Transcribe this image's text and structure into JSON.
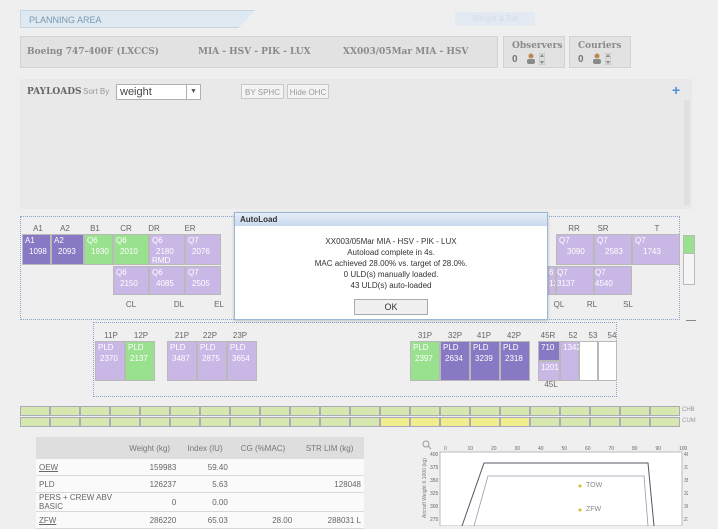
{
  "tabs": {
    "planning": "PLANNING AREA",
    "ghost": "Weight & Bal"
  },
  "flight": {
    "aircraft": "Boeing 747-400F (LXCCS)",
    "route": "MIA - HSV - PIK - LUX",
    "flight_id": "XX003/05Mar MIA - HSV"
  },
  "people": {
    "observers_label": "Observers",
    "observers_count": "0",
    "couriers_label": "Couriers",
    "couriers_count": "0"
  },
  "payloads": {
    "label": "PAYLOADS",
    "sort_label": "Sort By",
    "sort_value": "weight",
    "by_sphc": "BY SPHC",
    "hide_ohc": "Hide OHC",
    "add": "+"
  },
  "main_deck": {
    "top_labels": [
      "A1",
      "A2",
      "B1",
      "CR",
      "DR",
      "ER",
      "RR",
      "SR",
      "T"
    ],
    "cells_left": [
      {
        "k": "a1",
        "t": "A1",
        "w": "1098",
        "c": "dpurple"
      },
      {
        "k": "a2",
        "t": "A2",
        "w": "2093",
        "c": "dpurple"
      },
      {
        "k": "b1",
        "t": "Q6",
        "w": "1930",
        "c": "green"
      },
      {
        "k": "cr",
        "t": "Q6",
        "w": "2010",
        "c": "green"
      },
      {
        "k": "dr",
        "t": "Q6",
        "w": "2180",
        "c": "purple",
        "extra": "RMD"
      },
      {
        "k": "er",
        "t": "Q7",
        "w": "2076",
        "c": "purple"
      }
    ],
    "cells_left_lower": [
      {
        "k": "cl",
        "t": "Q6",
        "w": "2150",
        "c": "purple"
      },
      {
        "k": "dl",
        "t": "Q6",
        "w": "4085",
        "c": "purple"
      },
      {
        "k": "el",
        "t": "Q7",
        "w": "2505",
        "c": "purple"
      }
    ],
    "bottom_labels": [
      "CL",
      "DL",
      "EL",
      "QL",
      "RL",
      "SL"
    ],
    "cells_right": [
      {
        "k": "rr",
        "t": "Q7",
        "w": "3090",
        "c": "purple"
      },
      {
        "k": "sr",
        "t": "Q7",
        "w": "2583",
        "c": "purple"
      },
      {
        "k": "t",
        "t": "Q7",
        "w": "1743",
        "c": "purple"
      }
    ],
    "cells_right_lower": [
      {
        "k": "ql",
        "t": "6",
        "w": "125",
        "c": "purple"
      },
      {
        "k": "rl",
        "t": "Q7",
        "w": "3137",
        "c": "purple"
      },
      {
        "k": "sl",
        "t": "Q7",
        "w": "4540",
        "c": "purple"
      }
    ]
  },
  "lower_deck": {
    "labels": [
      "11P",
      "12P",
      "21P",
      "22P",
      "23P",
      "31P",
      "32P",
      "41P",
      "42P",
      "45R",
      "52",
      "53",
      "54",
      "45L"
    ],
    "cells": [
      {
        "k": "11p",
        "t": "PLD",
        "w": "2370",
        "c": "purple"
      },
      {
        "k": "12p",
        "t": "PLD",
        "w": "2137",
        "c": "green"
      },
      {
        "k": "21p",
        "t": "PLD",
        "w": "3487",
        "c": "purple"
      },
      {
        "k": "22p",
        "t": "PLD",
        "w": "2875",
        "c": "purple"
      },
      {
        "k": "23p",
        "t": "PLD",
        "w": "3654",
        "c": "purple"
      },
      {
        "k": "31p",
        "t": "PLD",
        "w": "2397",
        "c": "green"
      },
      {
        "k": "32p",
        "t": "PLD",
        "w": "2634",
        "c": "dpurple"
      },
      {
        "k": "41p",
        "t": "PLD",
        "w": "3239",
        "c": "dpurple"
      },
      {
        "k": "42p",
        "t": "PLD",
        "w": "2318",
        "c": "dpurple"
      },
      {
        "k": "45r",
        "t": "710",
        "w": "",
        "c": "dpurple"
      },
      {
        "k": "52",
        "t": "1342",
        "w": "",
        "c": "purple"
      },
      {
        "k": "45l",
        "t": "1201",
        "w": "",
        "c": "purple"
      }
    ]
  },
  "strip": {
    "chb": "CHB",
    "cum": "CUM"
  },
  "dialog": {
    "title": "AutoLoad",
    "line1": "XX003/05Mar MIA - HSV - PIK - LUX",
    "line2": "Autoload complete in 4s.",
    "line3": "MAC achieved 28.00% vs. target of 28.0%.",
    "line4": "0 ULD(s) manually loaded.",
    "line5": "43 ULD(s) auto-loaded",
    "ok": "OK"
  },
  "summary": {
    "headers": [
      "",
      "Weight (kg)",
      "Index (IU)",
      "CG (%MAC)",
      "STR LIM (kg)"
    ],
    "rows": [
      [
        "OEW",
        "159983",
        "59.40",
        "",
        ""
      ],
      [
        "PLD",
        "126237",
        "5.63",
        "",
        "128048"
      ],
      [
        "PERS + CREW ABV BASIC",
        "0",
        "0.00",
        "",
        ""
      ],
      [
        "ZFW",
        "286220",
        "65.03",
        "28.00",
        "288031 L"
      ]
    ]
  },
  "envelope": {
    "x_ticks": [
      "0",
      "10",
      "20",
      "30",
      "40",
      "50",
      "60",
      "70",
      "80",
      "90",
      "100"
    ],
    "y_ticks": [
      "400",
      "375",
      "350",
      "325",
      "300",
      "275"
    ],
    "ylabel": "Aircraft Weight X 1000 (kg)",
    "tow": "TOW",
    "zfw": "ZFW"
  }
}
